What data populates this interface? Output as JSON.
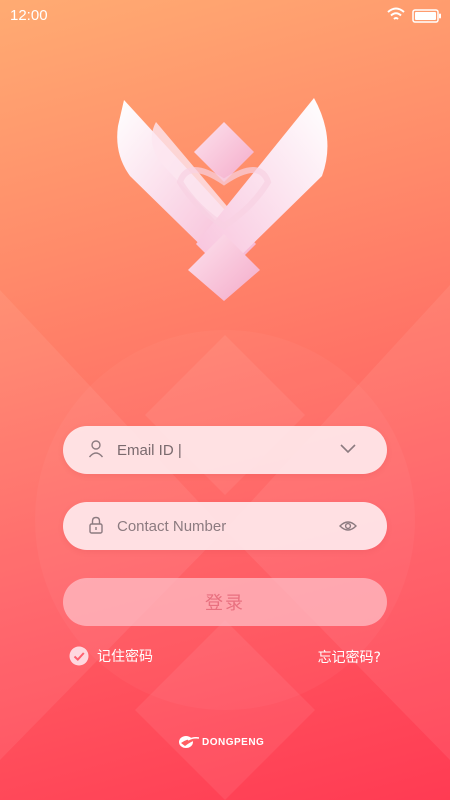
{
  "status_bar": {
    "time": "12:00"
  },
  "login": {
    "email_value": "Email ID",
    "contact_placeholder": "Contact Number",
    "login_label": "登录",
    "remember_label": "记住密码",
    "forgot_label": "忘记密码?"
  },
  "brand": {
    "name": "DONGPENG"
  },
  "icons": {
    "wifi": "wifi-icon",
    "battery": "battery-icon",
    "user": "user-icon",
    "lock": "lock-icon",
    "chevron": "chevron-down-icon",
    "eye": "eye-icon",
    "check": "check-icon",
    "logo": "brand-logo-icon"
  },
  "colors": {
    "gradient_top": "#ffab72",
    "gradient_bottom": "#ff3b53",
    "field_bg": "#ffecf0",
    "button_text": "#e8707f"
  }
}
